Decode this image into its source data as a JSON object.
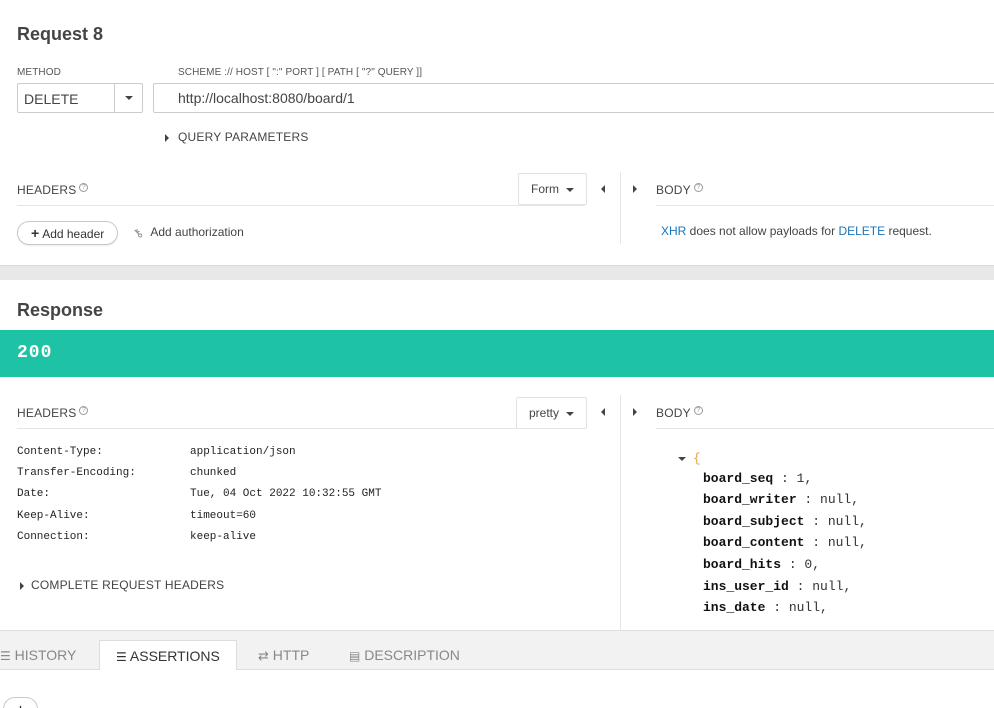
{
  "request": {
    "title": "Request 8",
    "method_label": "METHOD",
    "method_value": "DELETE",
    "url_label": "SCHEME :// HOST [ \":\" PORT ] [ PATH [ \"?\" QUERY ]]",
    "url_value": "http://localhost:8080/board/1",
    "query_params_label": "QUERY PARAMETERS",
    "headers_label": "HEADERS",
    "form_label": "Form",
    "body_label": "BODY",
    "add_header_label": "Add header",
    "add_auth_label": "Add authorization",
    "body_msg": {
      "xhr": "XHR",
      "middle": " does not allow payloads for ",
      "method": "DELETE",
      "end": " request."
    }
  },
  "response": {
    "title": "Response",
    "status": "200",
    "headers_label": "HEADERS",
    "pretty_label": "pretty",
    "body_label": "BODY",
    "headers": [
      {
        "key": "Content-Type:",
        "value": "application/json"
      },
      {
        "key": "Transfer-Encoding:",
        "value": "chunked"
      },
      {
        "key": "Date:",
        "value": "Tue, 04 Oct 2022 10:32:55 GMT"
      },
      {
        "key": "Keep-Alive:",
        "value": "timeout=60"
      },
      {
        "key": "Connection:",
        "value": "keep-alive"
      }
    ],
    "complete_headers_label": "COMPLETE REQUEST HEADERS",
    "json_open": "{",
    "json": [
      {
        "key": "board_seq",
        "value": "1"
      },
      {
        "key": "board_writer",
        "value": "null"
      },
      {
        "key": "board_subject",
        "value": "null"
      },
      {
        "key": "board_content",
        "value": "null"
      },
      {
        "key": "board_hits",
        "value": "0"
      },
      {
        "key": "ins_user_id",
        "value": "null"
      },
      {
        "key": "ins_date",
        "value": "null"
      }
    ]
  },
  "tabs": [
    {
      "label": "HISTORY"
    },
    {
      "label": "ASSERTIONS"
    },
    {
      "label": "HTTP"
    },
    {
      "label": "DESCRIPTION"
    }
  ],
  "colors": {
    "status_green": "#1ec3a6",
    "link_blue": "#1a73b8"
  }
}
